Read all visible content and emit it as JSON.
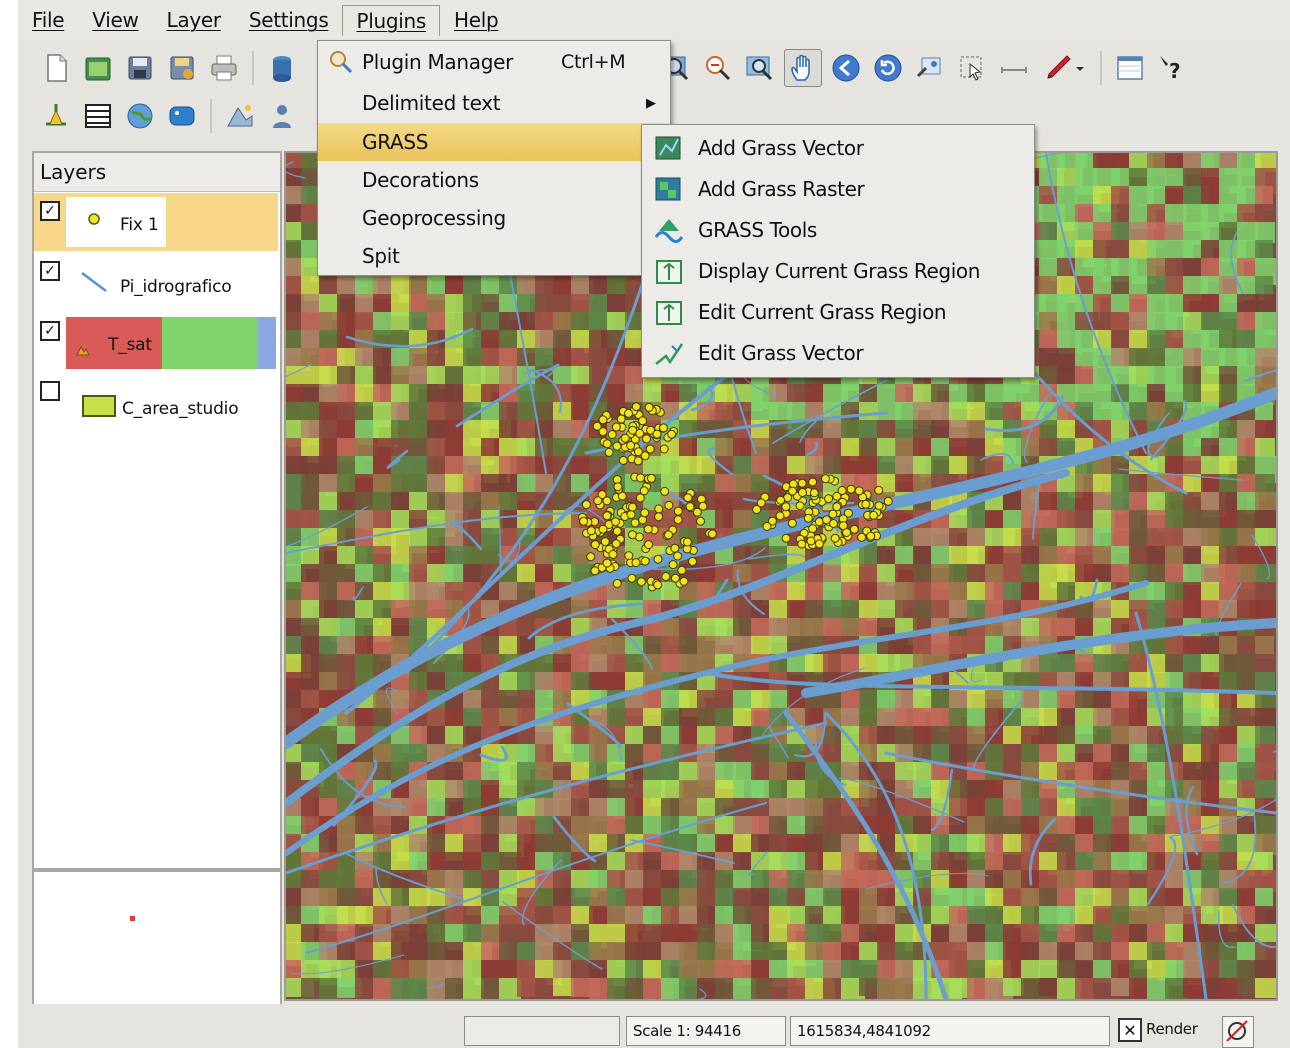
{
  "menubar": {
    "items": [
      {
        "label": "File"
      },
      {
        "label": "View"
      },
      {
        "label": "Layer"
      },
      {
        "label": "Settings"
      },
      {
        "label": "Plugins"
      },
      {
        "label": "Help"
      }
    ]
  },
  "plugins_menu": {
    "items": [
      {
        "label": "Plugin Manager",
        "shortcut": "Ctrl+M"
      },
      {
        "label": "Delimited text"
      },
      {
        "label": "GRASS"
      },
      {
        "label": "Decorations"
      },
      {
        "label": "Geoprocessing"
      },
      {
        "label": "Spit"
      }
    ],
    "highlighted": "GRASS"
  },
  "grass_submenu": {
    "items": [
      {
        "label": "Add Grass Vector",
        "icon": "grass-vector-icon"
      },
      {
        "label": "Add Grass Raster",
        "icon": "grass-raster-icon"
      },
      {
        "label": "GRASS Tools",
        "icon": "grass-tools-icon"
      },
      {
        "label": "Display Current Grass Region",
        "icon": "grass-region-icon"
      },
      {
        "label": "Edit Current Grass Region",
        "icon": "edit-region-icon"
      },
      {
        "label": "Edit Grass Vector",
        "icon": "edit-vector-icon"
      }
    ]
  },
  "layers": {
    "title": "Layers",
    "items": [
      {
        "name": "Fix 1",
        "checked": true,
        "symbol": "point"
      },
      {
        "name": "Pi_idrografico",
        "checked": true,
        "symbol": "line"
      },
      {
        "name": "T_sat",
        "checked": true,
        "symbol": "raster"
      },
      {
        "name": "C_area_studio",
        "checked": false,
        "symbol": "polygon"
      }
    ]
  },
  "statusbar": {
    "scale": "Scale 1: 94416",
    "coordinates": "1615834,4841092",
    "render_label": "Render"
  },
  "colors": {
    "selection_highlight": "#ecc763",
    "layer_point_bg": "#f7d88a",
    "raster_red": "#d95b57",
    "raster_green": "#7fd46c",
    "raster_blue": "#8aa9e4",
    "river_blue": "#6b9ed0"
  }
}
